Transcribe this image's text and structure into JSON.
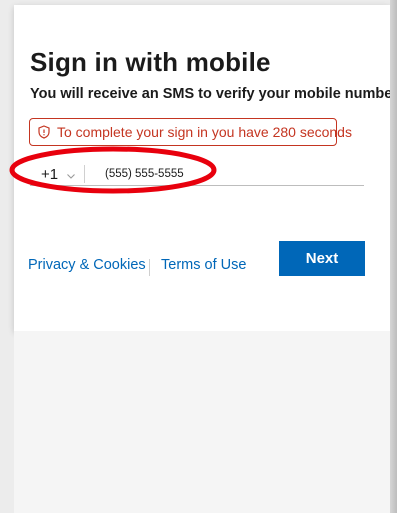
{
  "signin": {
    "title": "Sign in with mobile",
    "subtitle": "You will receive an SMS to verify your mobile number"
  },
  "alert": {
    "icon": "shield-icon",
    "text": "To complete your sign in you have 280 seconds",
    "color": "#c43521"
  },
  "phone": {
    "country_code": "+1",
    "number": "(555) 555-5555"
  },
  "footer": {
    "privacy_label": "Privacy & Cookies",
    "terms_label": "Terms of Use"
  },
  "actions": {
    "next_label": "Next",
    "accent_color": "#0067b8"
  },
  "annotation": {
    "shape": "ellipse",
    "color": "#e8000d"
  }
}
